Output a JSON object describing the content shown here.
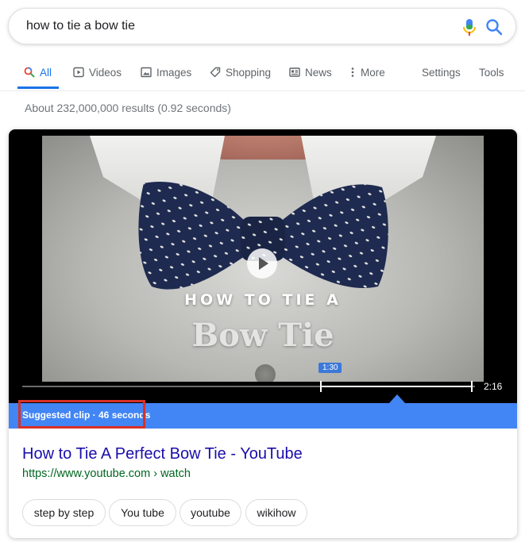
{
  "search": {
    "query": "how to tie a bow tie"
  },
  "tabs": [
    {
      "label": "All"
    },
    {
      "label": "Videos"
    },
    {
      "label": "Images"
    },
    {
      "label": "Shopping"
    },
    {
      "label": "News"
    },
    {
      "label": "More"
    },
    {
      "label": "Settings"
    },
    {
      "label": "Tools"
    }
  ],
  "results": {
    "stats": "About 232,000,000 results (0.92 seconds)"
  },
  "video": {
    "overlay_subtitle": "HOW TO TIE A",
    "overlay_title": "Bow Tie",
    "clip_start": "1:30",
    "duration": "2:16",
    "suggested_clip": "Suggested clip · 46 seconds",
    "accent_color": "#4285f4",
    "highlight_color": "#d93025"
  },
  "result": {
    "title": "How to Tie A Perfect Bow Tie - YouTube",
    "url": "https://www.youtube.com › watch"
  },
  "chips": [
    {
      "label": "step by step"
    },
    {
      "label": "You tube"
    },
    {
      "label": "youtube"
    },
    {
      "label": "wikihow"
    }
  ]
}
